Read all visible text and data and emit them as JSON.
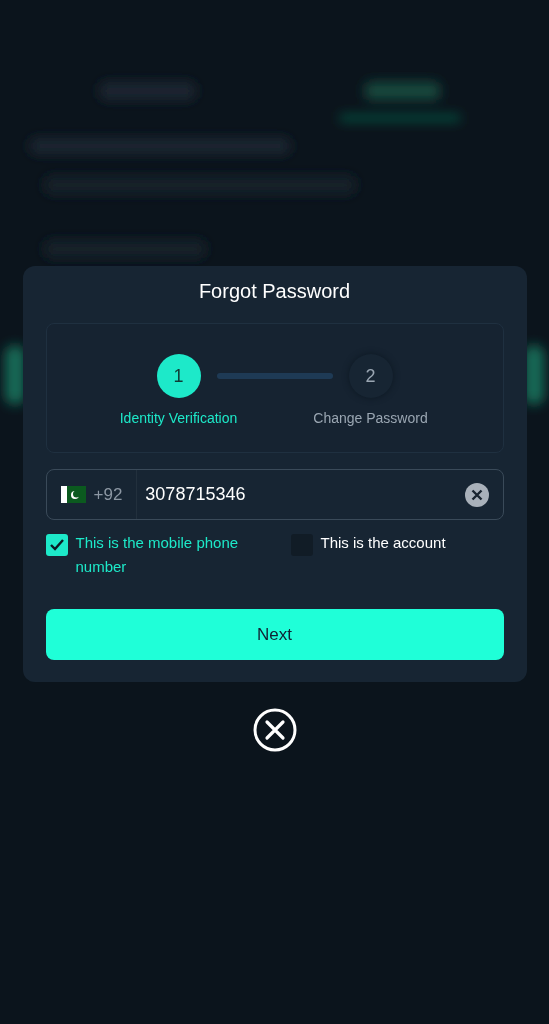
{
  "dialog": {
    "title": "Forgot Password",
    "steps": [
      {
        "number": "1",
        "label": "Identity Verification",
        "selected": true
      },
      {
        "number": "2",
        "label": "Change Password",
        "selected": false
      }
    ],
    "phone_field": {
      "country_code": "+92",
      "value": "3078715346"
    },
    "options": [
      {
        "label": "This is the mobile phone number",
        "checked": true
      },
      {
        "label": "This is the account",
        "checked": false
      }
    ],
    "next_button": "Next"
  }
}
